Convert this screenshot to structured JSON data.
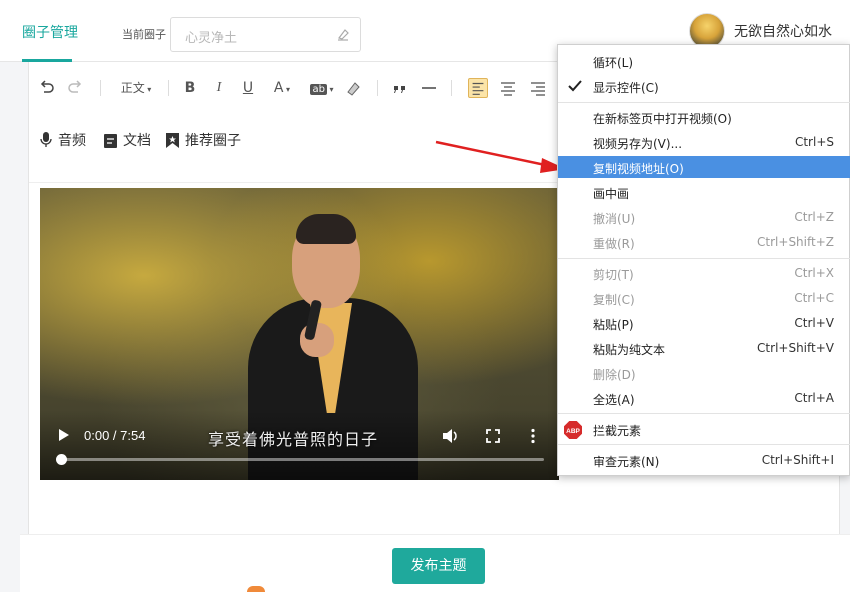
{
  "header": {
    "nav_tab": "圈子管理",
    "current_circle_label": "当前圈子",
    "circle_input_placeholder": "心灵净土",
    "user_name": "无欲自然心如水"
  },
  "editor": {
    "toolbar": {
      "heading_select": "正文",
      "bold": "B",
      "italic": "I",
      "underline": "U",
      "font_color": "A",
      "highlight": "ab"
    },
    "insert": {
      "audio": "音频",
      "document": "文档",
      "recommend_circle": "推荐圈子"
    }
  },
  "video": {
    "time": "0:00 / 7:54",
    "subtitle": "享受着佛光普照的日子",
    "progress": 0.0
  },
  "footer": {
    "publish_button": "发布主题"
  },
  "context_menu": {
    "items": [
      {
        "label": "循环(L)",
        "shortcut": "",
        "disabled": false,
        "checked": false
      },
      {
        "label": "显示控件(C)",
        "shortcut": "",
        "disabled": false,
        "checked": true
      },
      {
        "label": "在新标签页中打开视频(O)",
        "shortcut": "",
        "disabled": false
      },
      {
        "label": "视频另存为(V)...",
        "shortcut": "Ctrl+S",
        "disabled": false
      },
      {
        "label": "复制视频地址(O)",
        "shortcut": "",
        "disabled": false,
        "highlighted": true
      },
      {
        "label": "画中画",
        "shortcut": "",
        "disabled": false
      },
      {
        "label": "撤消(U)",
        "shortcut": "Ctrl+Z",
        "disabled": true
      },
      {
        "label": "重做(R)",
        "shortcut": "Ctrl+Shift+Z",
        "disabled": true
      },
      {
        "label": "剪切(T)",
        "shortcut": "Ctrl+X",
        "disabled": true
      },
      {
        "label": "复制(C)",
        "shortcut": "Ctrl+C",
        "disabled": true
      },
      {
        "label": "粘贴(P)",
        "shortcut": "Ctrl+V",
        "disabled": false
      },
      {
        "label": "粘贴为纯文本",
        "shortcut": "Ctrl+Shift+V",
        "disabled": false
      },
      {
        "label": "删除(D)",
        "shortcut": "",
        "disabled": true
      },
      {
        "label": "全选(A)",
        "shortcut": "Ctrl+A",
        "disabled": false
      },
      {
        "label": "拦截元素",
        "shortcut": "",
        "disabled": false
      },
      {
        "label": "审查元素(N)",
        "shortcut": "Ctrl+Shift+I",
        "disabled": false
      }
    ],
    "abp_icon_text": "ABP"
  },
  "colors": {
    "accent": "#19a79e",
    "menu_highlight": "#4a90e2",
    "arrow": "#e02020"
  }
}
